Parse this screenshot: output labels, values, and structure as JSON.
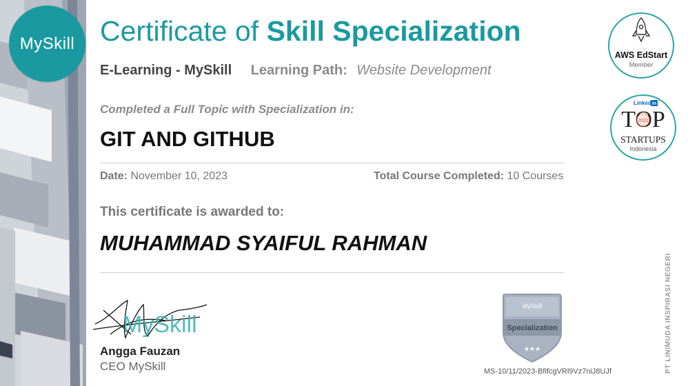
{
  "brand": {
    "logo_text": "MySkill",
    "accent_color": "#1a9aa0"
  },
  "header": {
    "title_regular": "Certificate of",
    "title_bold": "Skill Specialization",
    "organization": "E-Learning - MySkill",
    "learning_path_label": "Learning Path:",
    "learning_path_value": "Website Development"
  },
  "topic": {
    "label": "Completed a Full Topic with Specialization in:",
    "name": "GIT AND GITHUB"
  },
  "details": {
    "date_label": "Date:",
    "date_value": "November 10, 2023",
    "total_label": "Total Course Completed:",
    "total_value": "10 Courses"
  },
  "award": {
    "label": "This certificate is awarded to:",
    "recipient": "MUHAMMAD SYAIFUL RAHMAN"
  },
  "signatory": {
    "signature_text": "MySkill",
    "name": "Angga Fauzan",
    "title": "CEO MySkill"
  },
  "seal": {
    "brand": "MySkill",
    "label": "Specialization",
    "stars": "★★★",
    "certificate_id": "MS-10/11/2023-BfifcgVRl9Vz7niJ8UJf"
  },
  "badges": {
    "aws": {
      "title": "AWS EdStart",
      "subtitle": "Member",
      "icon": "rocket-icon"
    },
    "linkedin": {
      "brand": "Linked",
      "brand_in": "in",
      "top": "TOP",
      "year": "2022",
      "startups": "STARTUPS",
      "country": "Indonesia"
    }
  },
  "publisher": "PT LINIMUDA INSPIRASI NEGERI"
}
